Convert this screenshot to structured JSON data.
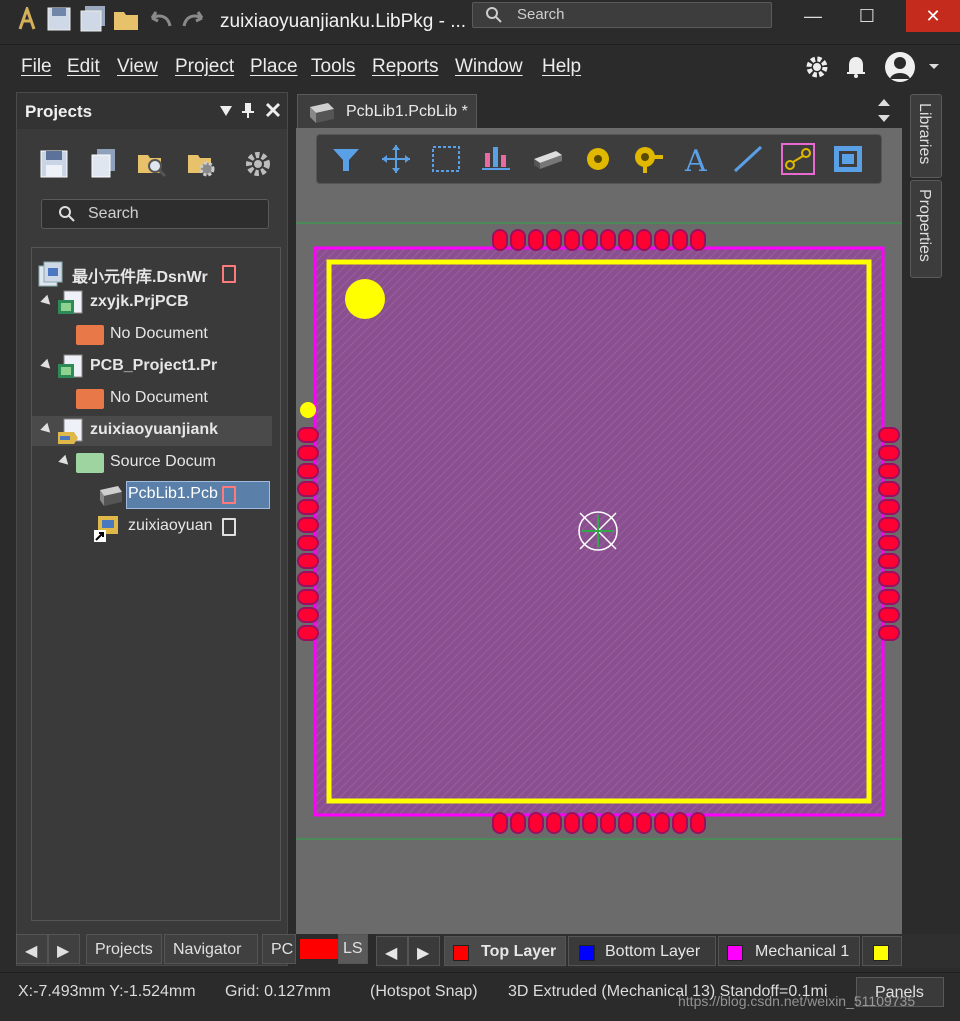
{
  "app": {
    "title": "zuixiaoyuanjianku.LibPkg - ...",
    "search_placeholder": "Search"
  },
  "menu": [
    "File",
    "Edit",
    "View",
    "Project",
    "Place",
    "Tools",
    "Reports",
    "Window",
    "Help"
  ],
  "projects_panel": {
    "title": "Projects",
    "search_placeholder": "Search",
    "tree": [
      {
        "label": "最小元件库.DsnWr",
        "level": 0,
        "icon": "workspace-icon",
        "bold": true
      },
      {
        "label": "zxyjk.PrjPCB",
        "level": 1,
        "icon": "pcb-project-icon",
        "bold": true
      },
      {
        "label": "No Document",
        "level": 2,
        "icon": "folder-orange-icon"
      },
      {
        "label": "PCB_Project1.Pr",
        "level": 1,
        "icon": "pcb-project-icon",
        "bold": true
      },
      {
        "label": "No Document",
        "level": 2,
        "icon": "folder-orange-icon"
      },
      {
        "label": "zuixiaoyuanjiank",
        "level": 1,
        "icon": "libpkg-icon",
        "bold": true
      },
      {
        "label": "Source Docum",
        "level": 2,
        "icon": "folder-green-icon"
      },
      {
        "label": "PcbLib1.Pcb",
        "level": 3,
        "icon": "pcblib-icon",
        "selected": true
      },
      {
        "label": "zuixiaoyuan",
        "level": 3,
        "icon": "schlib-icon"
      }
    ],
    "bottom_tabs": [
      "Projects",
      "Navigator",
      "PC"
    ],
    "ls_label": "LS"
  },
  "document_tab": {
    "label": "PcbLib1.PcbLib *"
  },
  "side_panels": [
    "Libraries",
    "Properties"
  ],
  "layers": [
    {
      "name": "Top Layer",
      "color": "#ff0000",
      "active": true
    },
    {
      "name": "Bottom Layer",
      "color": "#0000ff"
    },
    {
      "name": "Mechanical 1",
      "color": "#ff00ff"
    },
    {
      "name": "",
      "color": "#ffff00"
    }
  ],
  "status": {
    "coords": "X:-7.493mm Y:-1.524mm",
    "grid": "Grid: 0.127mm",
    "snap": "(Hotspot Snap)",
    "extruded": "3D Extruded  (Mechanical 13)  Standoff=0.1mi",
    "panels": "Panels",
    "watermark": "https://blog.csdn.net/weixin_51109735"
  },
  "colors": {
    "pad": "#ff0033",
    "body": "#8a4f8f",
    "silkscreen": "#ffff00",
    "outline": "#ff00ff",
    "accent_close": "#c42b1c"
  }
}
